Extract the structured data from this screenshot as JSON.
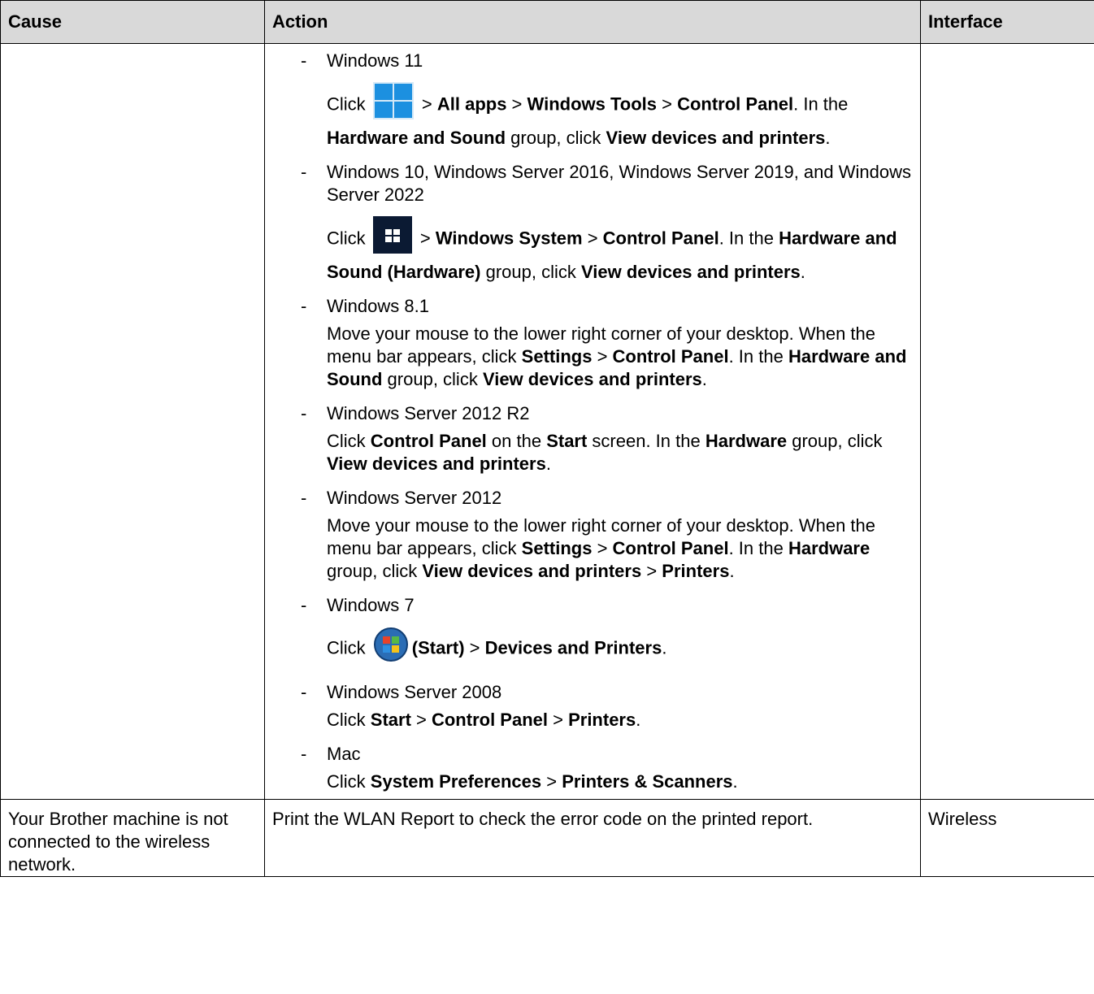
{
  "headers": {
    "cause": "Cause",
    "action": "Action",
    "interface": "Interface"
  },
  "os_items": [
    {
      "os": "Windows 11",
      "icon": "windows11-start-icon",
      "desc": [
        {
          "t": "Click "
        },
        {
          "icon": "windows11-start-icon"
        },
        {
          "t": " > "
        },
        {
          "b": "All apps"
        },
        {
          "t": " > "
        },
        {
          "b": "Windows Tools"
        },
        {
          "t": " > "
        },
        {
          "b": "Control Panel"
        },
        {
          "t": ". In the "
        },
        {
          "b": "Hardware and Sound"
        },
        {
          "t": " group, click "
        },
        {
          "b": "View devices and printers"
        },
        {
          "t": "."
        }
      ]
    },
    {
      "os": "Windows 10, Windows Server 2016, Windows Server 2019, and Windows Server 2022",
      "desc": [
        {
          "t": "Click "
        },
        {
          "icon": "windows10-start-icon"
        },
        {
          "t": " > "
        },
        {
          "b": "Windows System"
        },
        {
          "t": " > "
        },
        {
          "b": "Control Panel"
        },
        {
          "t": ". In the "
        },
        {
          "b": "Hardware and Sound (Hardware)"
        },
        {
          "t": " group, click "
        },
        {
          "b": "View devices and printers"
        },
        {
          "t": "."
        }
      ]
    },
    {
      "os": "Windows 8.1",
      "desc": [
        {
          "t": "Move your mouse to the lower right corner of your desktop. When the menu bar appears, click "
        },
        {
          "b": "Settings"
        },
        {
          "t": " > "
        },
        {
          "b": "Control Panel"
        },
        {
          "t": ". In the "
        },
        {
          "b": "Hardware and Sound"
        },
        {
          "t": " group, click "
        },
        {
          "b": "View devices and printers"
        },
        {
          "t": "."
        }
      ]
    },
    {
      "os": "Windows Server 2012 R2",
      "desc": [
        {
          "t": "Click "
        },
        {
          "b": "Control Panel"
        },
        {
          "t": " on the "
        },
        {
          "b": "Start"
        },
        {
          "t": " screen. In the "
        },
        {
          "b": "Hardware"
        },
        {
          "t": " group, click "
        },
        {
          "b": "View devices and printers"
        },
        {
          "t": "."
        }
      ]
    },
    {
      "os": "Windows Server 2012",
      "desc": [
        {
          "t": "Move your mouse to the lower right corner of your desktop. When the menu bar appears, click "
        },
        {
          "b": "Settings"
        },
        {
          "t": " > "
        },
        {
          "b": "Control Panel"
        },
        {
          "t": ". In the "
        },
        {
          "b": "Hardware"
        },
        {
          "t": " group, click "
        },
        {
          "b": "View devices and printers"
        },
        {
          "t": " > "
        },
        {
          "b": "Printers"
        },
        {
          "t": "."
        }
      ]
    },
    {
      "os": "Windows 7",
      "desc": [
        {
          "t": "Click "
        },
        {
          "icon": "windows7-start-orb-icon"
        },
        {
          "b": "(Start)"
        },
        {
          "t": " > "
        },
        {
          "b": "Devices and Printers"
        },
        {
          "t": "."
        }
      ]
    },
    {
      "os": "Windows Server 2008",
      "desc": [
        {
          "t": "Click "
        },
        {
          "b": "Start"
        },
        {
          "t": " > "
        },
        {
          "b": "Control Panel"
        },
        {
          "t": " > "
        },
        {
          "b": "Printers"
        },
        {
          "t": "."
        }
      ]
    },
    {
      "os": "Mac",
      "desc": [
        {
          "t": "Click "
        },
        {
          "b": "System Preferences"
        },
        {
          "t": " > "
        },
        {
          "b": "Printers & Scanners"
        },
        {
          "t": "."
        }
      ]
    }
  ],
  "row2": {
    "cause": "Your Brother machine is not connected to the wireless network.",
    "action": "Print the WLAN Report to check the error code on the printed report.",
    "interface": "Wireless"
  },
  "colors": {
    "header_bg": "#d9d9d9",
    "win11_blue": "#1c90e0",
    "win10_bg": "#0b1a33"
  }
}
